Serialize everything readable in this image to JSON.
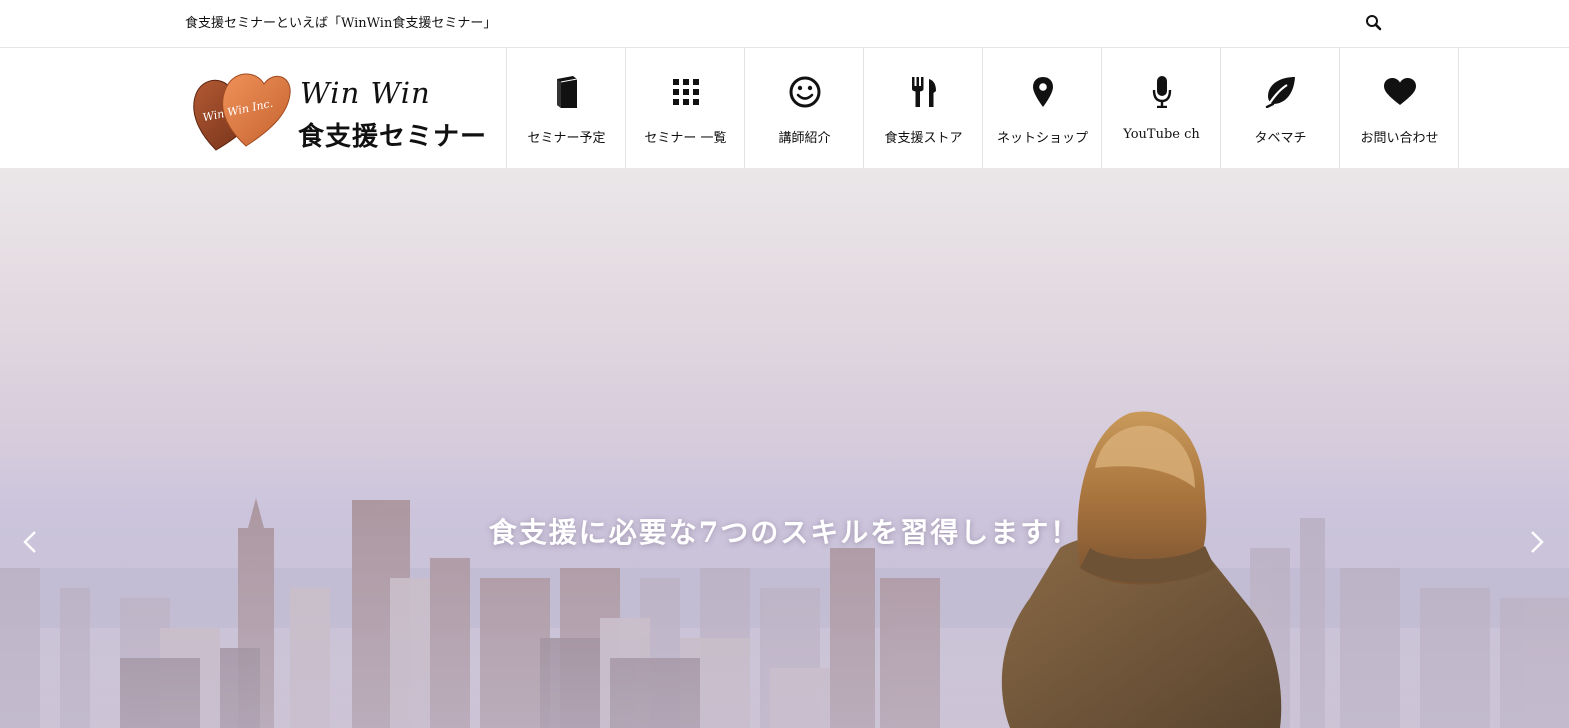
{
  "topbar": {
    "tagline": "食支援セミナーといえば「WinWin食支援セミナー」",
    "search_icon": "search-icon"
  },
  "logo": {
    "badge_text": "Win Win Inc.",
    "title_en": "Win Win",
    "title_ja": "食支援セミナー",
    "heart_colors": [
      "#8a3f22",
      "#d97a45"
    ]
  },
  "nav": {
    "items": [
      {
        "label": "セミナー予定",
        "icon": "book-icon"
      },
      {
        "label": "セミナー 一覧",
        "icon": "grid-icon"
      },
      {
        "label": "講師紹介",
        "icon": "smiley-icon"
      },
      {
        "label": "食支援ストア",
        "icon": "fork-knife-icon"
      },
      {
        "label": "ネットショップ",
        "icon": "map-pin-icon"
      },
      {
        "label": "YouTube ch",
        "icon": "microphone-icon"
      },
      {
        "label": "タベマチ",
        "icon": "leaf-icon"
      },
      {
        "label": "お問い合わせ",
        "icon": "heart-icon"
      }
    ]
  },
  "hero": {
    "caption": "食支援に必要な7つのスキルを習得します！",
    "prev_icon": "chevron-left-icon",
    "next_icon": "chevron-right-icon"
  }
}
